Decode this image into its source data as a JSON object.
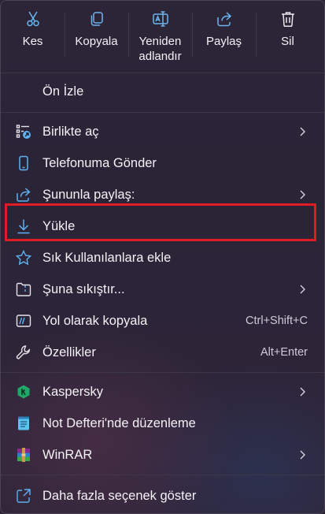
{
  "toolbar": {
    "cut": "Kes",
    "copy": "Kopyala",
    "rename": "Yeniden adlandır",
    "share": "Paylaş",
    "delete": "Sil"
  },
  "items": {
    "preview": "Ön İzle",
    "open_with": "Birlikte aç",
    "send_to_phone": "Telefonuma Gönder",
    "share_with": "Şununla paylaş:",
    "upload": "Yükle",
    "add_favorites": "Sık Kullanılanlara ekle",
    "compress_to": "Şuna sıkıştır...",
    "copy_as_path": "Yol olarak kopyala",
    "copy_as_path_shortcut": "Ctrl+Shift+C",
    "properties": "Özellikler",
    "properties_shortcut": "Alt+Enter",
    "kaspersky": "Kaspersky",
    "notepad_edit": "Not Defteri'nde düzenleme",
    "winrar": "WinRAR",
    "more_options": "Daha fazla seçenek göster"
  },
  "colors": {
    "accent": "#5fb2f2",
    "highlight_border": "#e01b22"
  }
}
